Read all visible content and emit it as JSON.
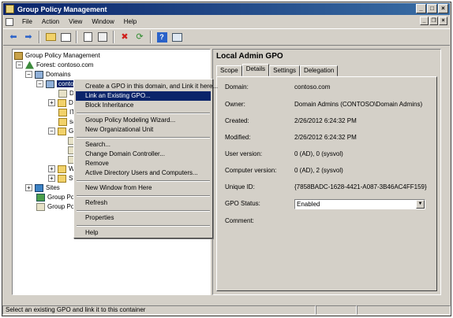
{
  "window": {
    "title": "Group Policy Management"
  },
  "menubar": {
    "items": [
      "File",
      "Action",
      "View",
      "Window",
      "Help"
    ]
  },
  "toolbar": {
    "icons": [
      "back-icon",
      "forward-icon",
      "up-folder-icon",
      "show-hide-tree-icon",
      "copy-icon",
      "properties-icon",
      "delete-icon",
      "refresh-icon",
      "help-icon",
      "console-icon"
    ]
  },
  "tree": {
    "root": "Group Policy Management",
    "forest": "Forest: contoso.com",
    "domains": "Domains",
    "domain": "conto",
    "child1": "D",
    "child2": "D",
    "child3": "IT",
    "child4": "sa",
    "child5": "G",
    "child6": "W",
    "child7": "St",
    "sites": "Sites",
    "modeling": "Group Pol",
    "results": "Group Pol"
  },
  "details": {
    "title": "Local Admin GPO",
    "tabs": [
      "Scope",
      "Details",
      "Settings",
      "Delegation"
    ],
    "active_tab": "Details",
    "rows": [
      {
        "label": "Domain:",
        "value": "contoso.com"
      },
      {
        "label": "Owner:",
        "value": "Domain Admins (CONTOSO\\Domain Admins)"
      },
      {
        "label": "Created:",
        "value": "2/26/2012 6:24:32 PM"
      },
      {
        "label": "Modified:",
        "value": "2/26/2012 6:24:32 PM"
      },
      {
        "label": "User version:",
        "value": "0 (AD), 0 (sysvol)"
      },
      {
        "label": "Computer version:",
        "value": "0 (AD), 2 (sysvol)"
      },
      {
        "label": "Unique ID:",
        "value": "{7858BADC-1628-4421-A087-3B46AC4FF159}"
      }
    ],
    "status_label": "GPO Status:",
    "status_value": "Enabled",
    "comment_label": "Comment:"
  },
  "context_menu": {
    "items": [
      "Create a GPO in this domain, and Link it here...",
      "Link an Existing GPO...",
      "Block Inheritance",
      "Group Policy Modeling Wizard...",
      "New Organizational Unit",
      "Search...",
      "Change Domain Controller...",
      "Remove",
      "Active Directory Users and Computers...",
      "New Window from Here",
      "Refresh",
      "Properties",
      "Help"
    ],
    "highlighted": "Link an Existing GPO..."
  },
  "statusbar": {
    "text": "Select an existing GPO and link it to this container"
  }
}
